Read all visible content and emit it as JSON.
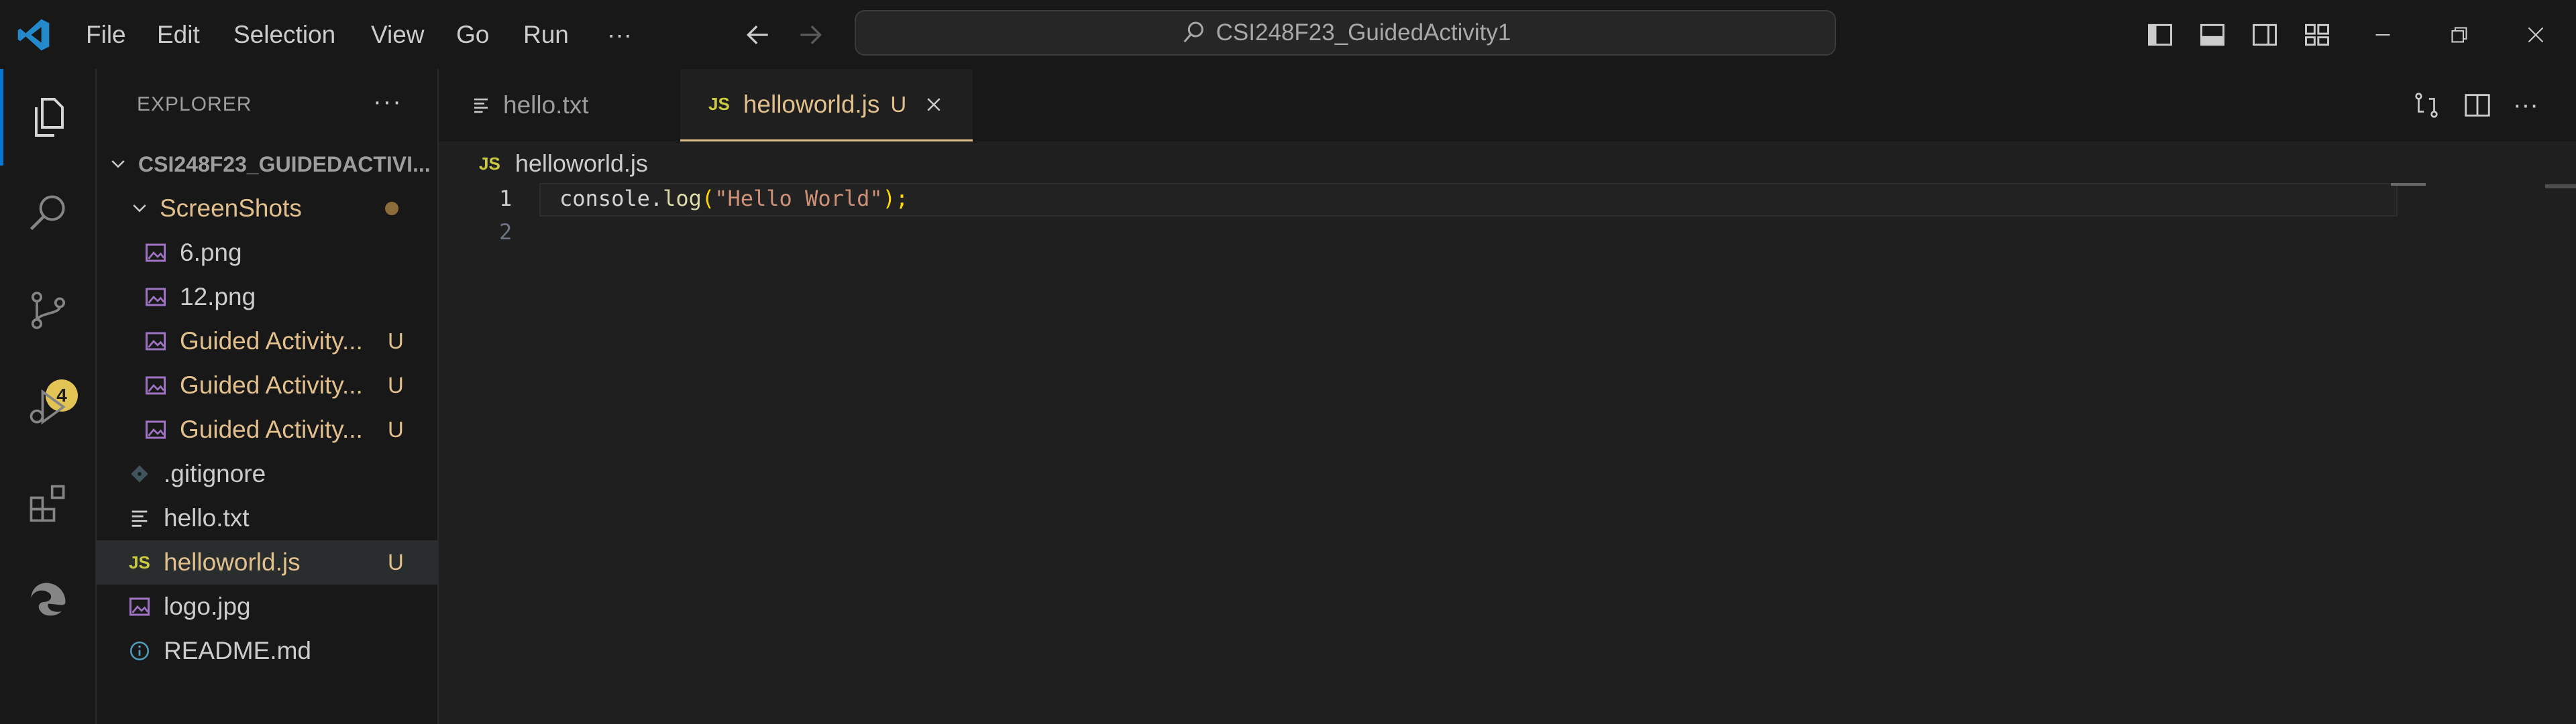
{
  "menu": {
    "items": [
      "File",
      "Edit",
      "Selection",
      "View",
      "Go",
      "Run"
    ],
    "more_label": "···"
  },
  "search": {
    "label": "CSI248F23_GuidedActivity1"
  },
  "activity": {
    "scm_badge": "4"
  },
  "sidebar": {
    "title": "EXPLORER",
    "more_label": "···",
    "root_label": "CSI248F23_GUIDEDACTIVI...",
    "folder_label": "ScreenShots",
    "items": [
      {
        "label": "6.png",
        "status": ""
      },
      {
        "label": "12.png",
        "status": ""
      },
      {
        "label": "Guided Activity...",
        "status": "U"
      },
      {
        "label": "Guided Activity...",
        "status": "U"
      },
      {
        "label": "Guided Activity...",
        "status": "U"
      },
      {
        "label": ".gitignore",
        "status": ""
      },
      {
        "label": "hello.txt",
        "status": ""
      },
      {
        "label": "helloworld.js",
        "status": "U"
      },
      {
        "label": "logo.jpg",
        "status": ""
      },
      {
        "label": "README.md",
        "status": ""
      }
    ]
  },
  "tabs": [
    {
      "label": "hello.txt",
      "status": ""
    },
    {
      "label": "helloworld.js",
      "status": "U",
      "js_badge": "JS"
    }
  ],
  "editor": {
    "breadcrumb": "helloworld.js",
    "breadcrumb_badge": "JS",
    "line_numbers": [
      "1",
      "2"
    ],
    "code": {
      "obj": "console",
      "dot": ".",
      "fn": "log",
      "open": "(",
      "str": "\"Hello World\"",
      "close": ");"
    }
  },
  "colors": {
    "accent": "#0078d4",
    "modified": "#e2c08d",
    "js_yellow": "#cbcb41",
    "badge": "#e2c454"
  }
}
